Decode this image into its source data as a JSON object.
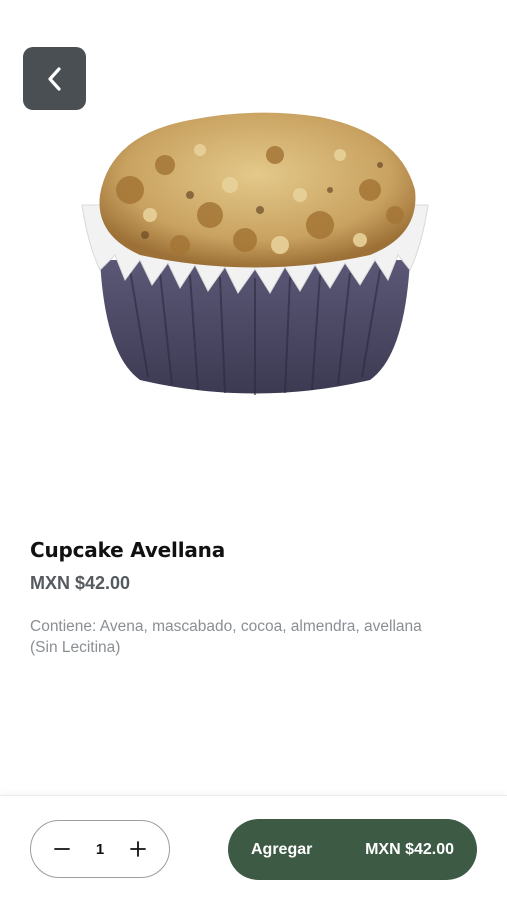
{
  "header": {
    "back_icon": "chevron-left-icon"
  },
  "product": {
    "image_icon": "cupcake-image",
    "name": "Cupcake Avellana",
    "price": "MXN $42.00",
    "description": "Contiene: Avena, mascabado, cocoa, almendra, avellana (Sin Lecitina)"
  },
  "footer": {
    "quantity": "1",
    "minus_icon": "minus-icon",
    "plus_icon": "plus-icon",
    "add_label": "Agregar",
    "add_price": "MXN $42.00"
  },
  "colors": {
    "back_button": "#4a4f54",
    "accent": "#3c5a44",
    "title": "#111111",
    "price": "#555a5f",
    "description": "#8a8f94"
  }
}
